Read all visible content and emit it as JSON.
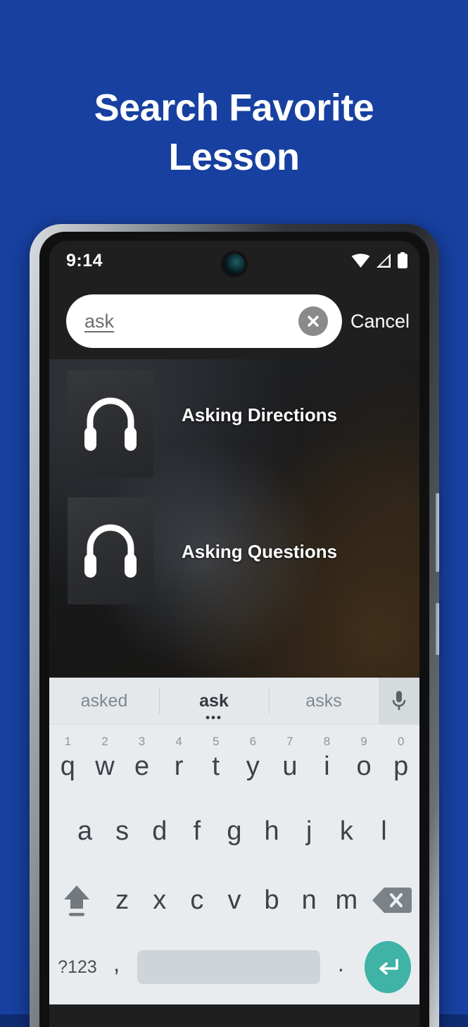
{
  "promo": {
    "background_color": "#1740A0",
    "title": "Search Favorite\nLesson"
  },
  "phone": {
    "status_bar": {
      "time": "9:14",
      "icons": [
        "wifi-icon",
        "cell-signal-icon",
        "battery-icon"
      ],
      "camera": "front-camera-punch-hole"
    },
    "search": {
      "value": "ask",
      "placeholder": "Search",
      "clear_icon": "close-circle-icon",
      "cancel_label": "Cancel"
    },
    "results": [
      {
        "title": "Asking Directions",
        "icon": "headphones-icon"
      },
      {
        "title": "Asking Questions",
        "icon": "headphones-icon"
      }
    ],
    "keyboard": {
      "suggestions": [
        {
          "text": "asked",
          "active": false
        },
        {
          "text": "ask",
          "active": true,
          "more": "•••"
        },
        {
          "text": "asks",
          "active": false
        }
      ],
      "mic_icon": "microphone-icon",
      "row1": [
        {
          "letter": "q",
          "num": "1"
        },
        {
          "letter": "w",
          "num": "2"
        },
        {
          "letter": "e",
          "num": "3"
        },
        {
          "letter": "r",
          "num": "4"
        },
        {
          "letter": "t",
          "num": "5"
        },
        {
          "letter": "y",
          "num": "6"
        },
        {
          "letter": "u",
          "num": "7"
        },
        {
          "letter": "i",
          "num": "8"
        },
        {
          "letter": "o",
          "num": "9"
        },
        {
          "letter": "p",
          "num": "0"
        }
      ],
      "row2": [
        {
          "letter": "a"
        },
        {
          "letter": "s"
        },
        {
          "letter": "d"
        },
        {
          "letter": "f"
        },
        {
          "letter": "g"
        },
        {
          "letter": "h"
        },
        {
          "letter": "j"
        },
        {
          "letter": "k"
        },
        {
          "letter": "l"
        }
      ],
      "row3": [
        {
          "letter": "z"
        },
        {
          "letter": "x"
        },
        {
          "letter": "c"
        },
        {
          "letter": "v"
        },
        {
          "letter": "b"
        },
        {
          "letter": "n"
        },
        {
          "letter": "m"
        }
      ],
      "shift_icon": "shift-arrow-icon",
      "backspace_icon": "backspace-icon",
      "symbols_label": "?123",
      "comma_label": ",",
      "period_label": ".",
      "space_label": "",
      "enter_icon": "enter-return-icon",
      "enter_color": "#3FB3A6"
    }
  }
}
